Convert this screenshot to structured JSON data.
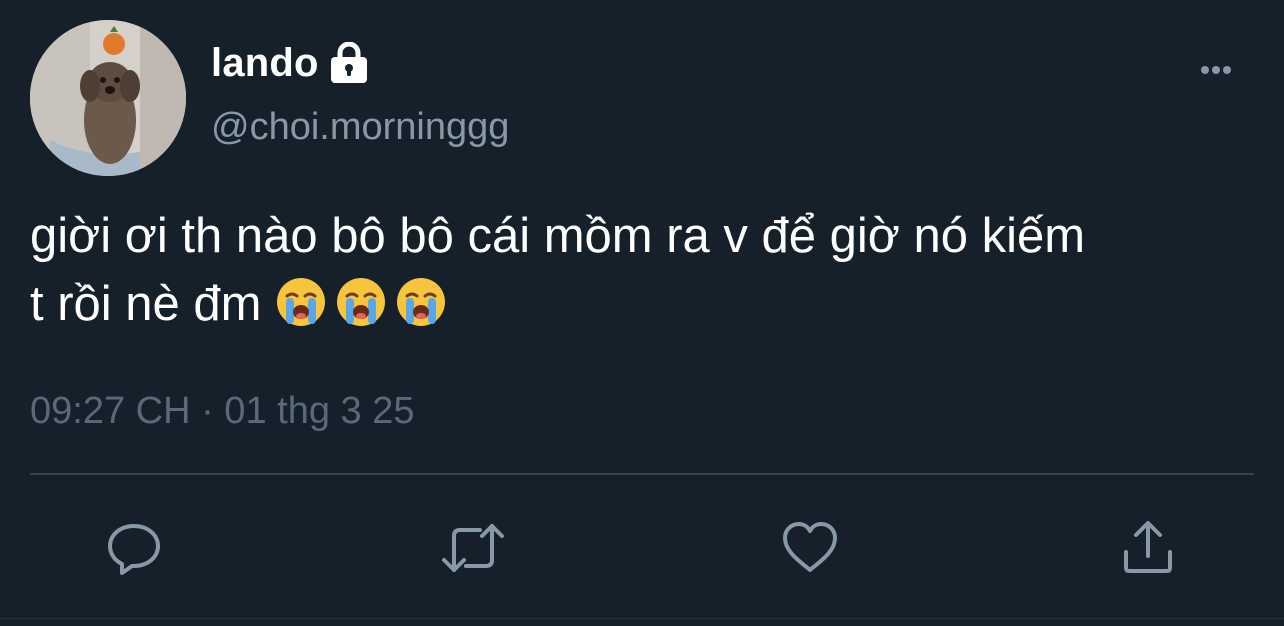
{
  "tweet": {
    "display_name": "lando",
    "handle": "@choi.morninggg",
    "text_line1": "giời ơi th nào bô bô cái mồm ra v để giờ nó kiếm",
    "text_line2": "t rồi nè đm ",
    "emojis": [
      "loudly-crying-face",
      "loudly-crying-face",
      "loudly-crying-face"
    ],
    "timestamp": "09:27 CH · 01 thg 3 25",
    "protected": true
  },
  "icons": {
    "lock": "lock-icon",
    "more": "more-horizontal-icon",
    "reply": "reply-icon",
    "retweet": "retweet-icon",
    "like": "heart-icon",
    "share": "share-icon"
  },
  "colors": {
    "background": "#15202b",
    "text": "#ffffff",
    "secondary": "#8899a6",
    "muted": "#586a7a",
    "divider": "#38444d"
  }
}
